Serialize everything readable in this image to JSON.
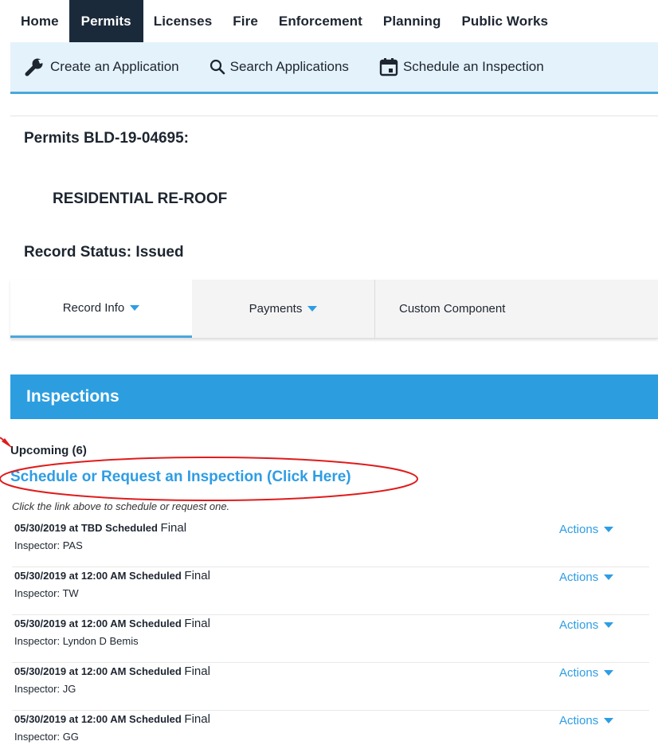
{
  "top_nav": {
    "tabs": [
      {
        "label": "Home"
      },
      {
        "label": "Permits",
        "active": true
      },
      {
        "label": "Licenses"
      },
      {
        "label": "Fire"
      },
      {
        "label": "Enforcement"
      },
      {
        "label": "Planning"
      },
      {
        "label": "Public Works"
      }
    ]
  },
  "sub_nav": {
    "create_label": "Create an Application",
    "search_label": "Search Applications",
    "schedule_label": "Schedule an Inspection"
  },
  "record": {
    "title": "Permits BLD-19-04695:",
    "type": "RESIDENTIAL RE-ROOF",
    "status": "Record Status: Issued"
  },
  "record_tabs": {
    "record_info": "Record Info",
    "payments": "Payments",
    "custom_component": "Custom Component"
  },
  "inspections": {
    "heading": "Inspections",
    "upcoming_label": "Upcoming (6)",
    "schedule_link": "Schedule or Request an Inspection (Click Here)",
    "note": "Click the link above to schedule or request one.",
    "actions_label": "Actions",
    "items": [
      {
        "datetime": "05/30/2019 at TBD Scheduled",
        "type": "Final",
        "inspector": "Inspector: PAS"
      },
      {
        "datetime": "05/30/2019 at 12:00 AM Scheduled",
        "type": "Final",
        "inspector": "Inspector: TW"
      },
      {
        "datetime": "05/30/2019 at 12:00 AM Scheduled",
        "type": "Final",
        "inspector": "Inspector: Lyndon D Bemis"
      },
      {
        "datetime": "05/30/2019 at 12:00 AM Scheduled",
        "type": "Final",
        "inspector": "Inspector: JG"
      },
      {
        "datetime": "05/30/2019 at 12:00 AM Scheduled",
        "type": "Final",
        "inspector": "Inspector: GG"
      }
    ]
  },
  "colors": {
    "nav_active": "#1b2a3a",
    "accent_blue": "#2c9ee0",
    "link_blue": "#2e9de4",
    "subnav_bg": "#e4f2fb",
    "annotation_red": "#e01b1b"
  }
}
